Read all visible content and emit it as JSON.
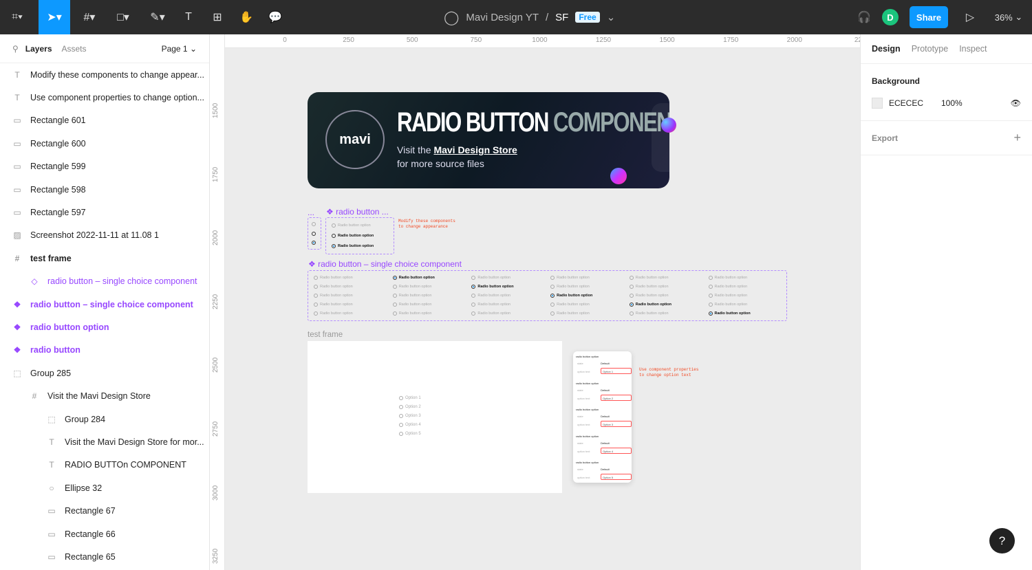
{
  "topbar": {
    "file_owner": "Mavi Design YT",
    "separator": "/",
    "file_name": "SF",
    "plan_badge": "Free",
    "avatar_initial": "D",
    "share_label": "Share",
    "zoom": "36%"
  },
  "left": {
    "tabs": [
      "Layers",
      "Assets"
    ],
    "page": "Page 1",
    "layers": [
      {
        "icon": "text",
        "label": "Modify these components to change appear...",
        "indent": 0,
        "style": ""
      },
      {
        "icon": "text",
        "label": "Use component properties to change option...",
        "indent": 0,
        "style": ""
      },
      {
        "icon": "rect",
        "label": "Rectangle 601",
        "indent": 0,
        "style": ""
      },
      {
        "icon": "rect",
        "label": "Rectangle 600",
        "indent": 0,
        "style": ""
      },
      {
        "icon": "rect",
        "label": "Rectangle 599",
        "indent": 0,
        "style": ""
      },
      {
        "icon": "rect",
        "label": "Rectangle 598",
        "indent": 0,
        "style": ""
      },
      {
        "icon": "rect",
        "label": "Rectangle 597",
        "indent": 0,
        "style": ""
      },
      {
        "icon": "image",
        "label": "Screenshot 2022-11-11 at 11.08 1",
        "indent": 0,
        "style": ""
      },
      {
        "icon": "frame",
        "label": "test frame",
        "indent": 0,
        "style": "bold"
      },
      {
        "icon": "instance",
        "label": "radio button – single choice component",
        "indent": 1,
        "style": "purple"
      },
      {
        "icon": "component",
        "label": "radio button – single choice component",
        "indent": 0,
        "style": "purple bold"
      },
      {
        "icon": "component",
        "label": "radio button option",
        "indent": 0,
        "style": "purple bold"
      },
      {
        "icon": "component",
        "label": "radio button",
        "indent": 0,
        "style": "purple bold"
      },
      {
        "icon": "group",
        "label": "Group 285",
        "indent": 0,
        "style": ""
      },
      {
        "icon": "frame",
        "label": "Visit the Mavi Design Store",
        "indent": 1,
        "style": ""
      },
      {
        "icon": "group",
        "label": "Group 284",
        "indent": 2,
        "style": ""
      },
      {
        "icon": "text",
        "label": "Visit the Mavi Design Store for mor...",
        "indent": 2,
        "style": ""
      },
      {
        "icon": "text",
        "label": "RADIO BUTTOn COMPONENT",
        "indent": 2,
        "style": ""
      },
      {
        "icon": "ellipse",
        "label": "Ellipse 32",
        "indent": 2,
        "style": ""
      },
      {
        "icon": "rect",
        "label": "Rectangle 67",
        "indent": 2,
        "style": ""
      },
      {
        "icon": "rect",
        "label": "Rectangle 66",
        "indent": 2,
        "style": ""
      },
      {
        "icon": "rect",
        "label": "Rectangle 65",
        "indent": 2,
        "style": ""
      }
    ]
  },
  "right": {
    "tabs": [
      "Design",
      "Prototype",
      "Inspect"
    ],
    "background_label": "Background",
    "bg_hex": "ECECEC",
    "bg_opacity": "100%",
    "export_label": "Export"
  },
  "rulers": {
    "h": [
      "0",
      "250",
      "500",
      "750",
      "1000",
      "1250",
      "1500",
      "1750",
      "2000",
      "22"
    ],
    "v": [
      "1500",
      "1750",
      "2000",
      "2250",
      "2500",
      "2750",
      "3000",
      "3250"
    ]
  },
  "banner": {
    "logo": "mavi",
    "title_a": "RADIO BUTTON",
    "title_b": "COMPONENT",
    "line1": "Visit the",
    "link": "Mavi Design Store",
    "line2": "for more source files"
  },
  "components": {
    "small_label": "...",
    "radio_label": "radio button ...",
    "option_text": "Radio button option",
    "note1": "Modify these components\nto change appearance",
    "single_label": "radio button – single choice component",
    "grid_selected": [
      -1,
      0,
      1,
      2,
      3,
      4
    ]
  },
  "test_frame": {
    "label": "test frame",
    "options": [
      "Option 1",
      "Option 2",
      "Option 3",
      "Option 4",
      "Option 5"
    ],
    "panel": {
      "group_label": "radio button option",
      "state_label": "state",
      "state_value": "Default",
      "text_label": "option text"
    },
    "note2": "Use component properties\nto change option text"
  },
  "help": "?",
  "colors": {
    "accent": "#0d99ff",
    "component": "#9747ff",
    "note": "#f24822"
  }
}
